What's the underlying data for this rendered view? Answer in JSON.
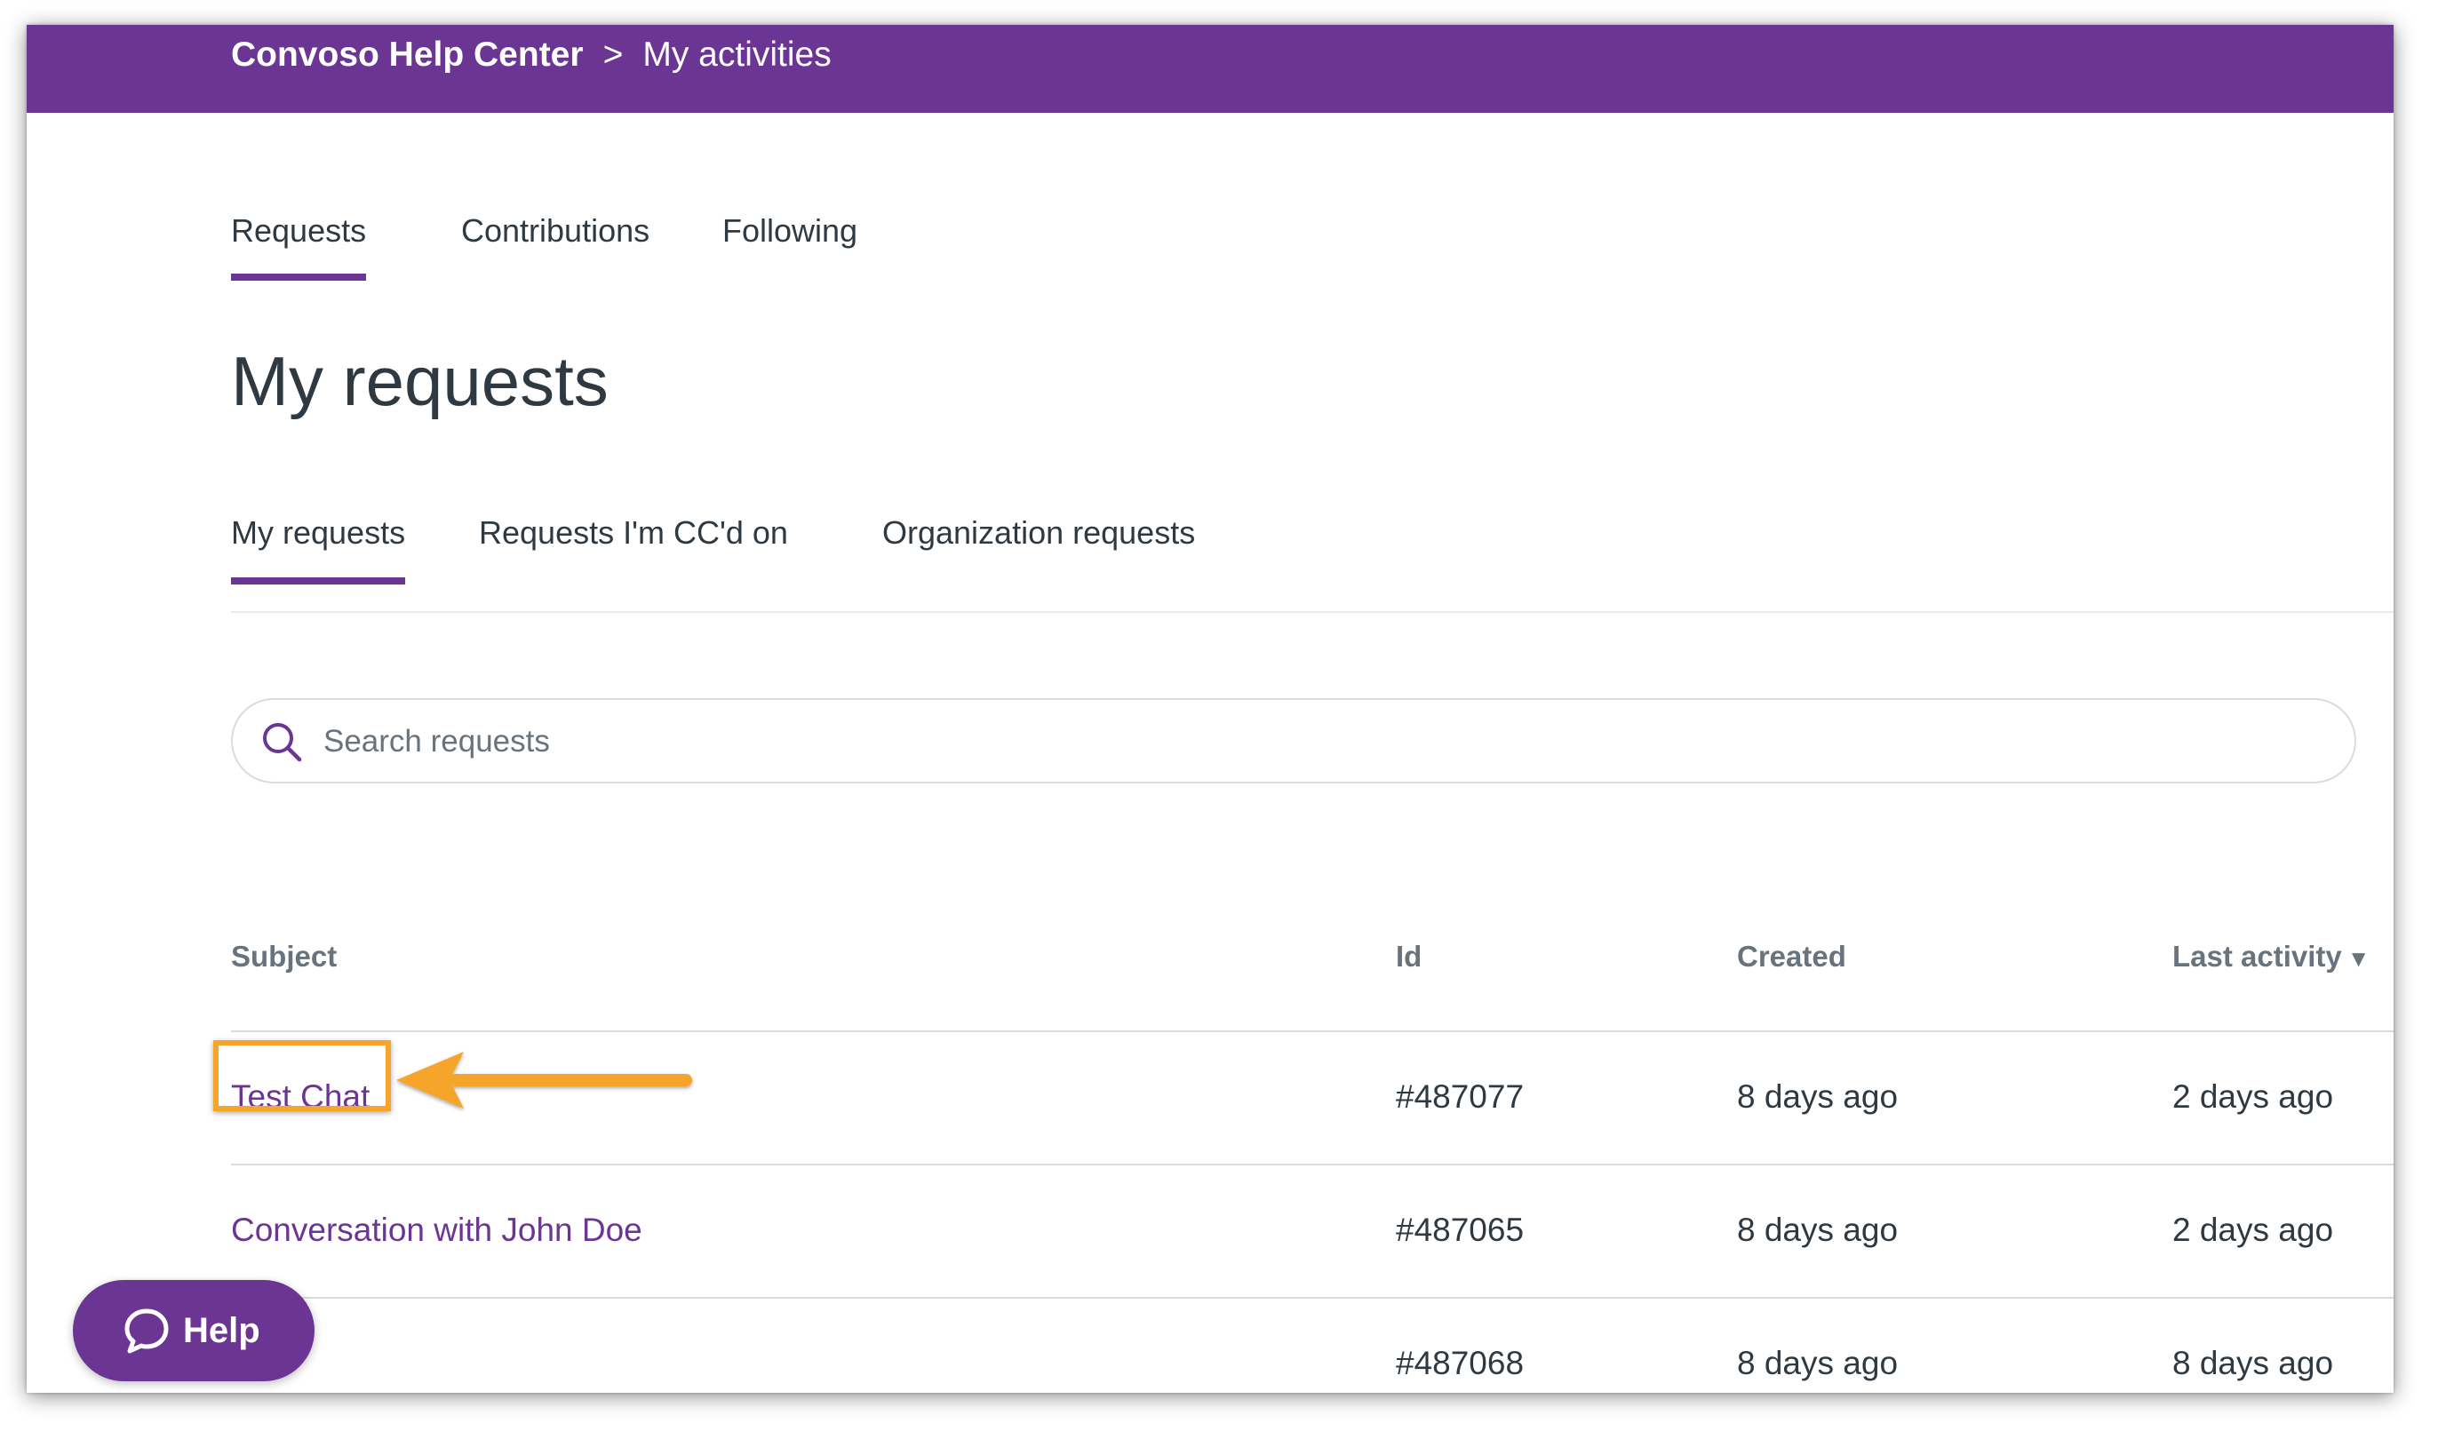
{
  "breadcrumb": {
    "home": "Convoso Help Center",
    "separator": ">",
    "current": "My activities"
  },
  "activity_tabs": [
    {
      "label": "Requests",
      "active": true
    },
    {
      "label": "Contributions",
      "active": false
    },
    {
      "label": "Following",
      "active": false
    }
  ],
  "page_title": "My requests",
  "request_tabs": [
    {
      "label": "My requests",
      "active": true
    },
    {
      "label": "Requests I'm CC'd on",
      "active": false
    },
    {
      "label": "Organization requests",
      "active": false
    }
  ],
  "search": {
    "placeholder": "Search requests",
    "value": "",
    "icon": "search-icon"
  },
  "table": {
    "columns": [
      "Subject",
      "Id",
      "Created",
      "Last activity"
    ],
    "sort_indicator": "▼",
    "rows": [
      {
        "subject": "Test Chat",
        "id": "#487077",
        "created": "8 days ago",
        "last_activity": "2 days ago"
      },
      {
        "subject": "Conversation with John Doe",
        "id": "#487065",
        "created": "8 days ago",
        "last_activity": "2 days ago"
      },
      {
        "subject": "",
        "id": "#487068",
        "created": "8 days ago",
        "last_activity": "8 days ago"
      }
    ]
  },
  "help_button": {
    "label": "Help",
    "icon": "chat-bubble-icon"
  },
  "colors": {
    "brand": "#6b3593",
    "annotation": "#f4a52a",
    "text": "#2f3941",
    "muted": "#68737d"
  }
}
